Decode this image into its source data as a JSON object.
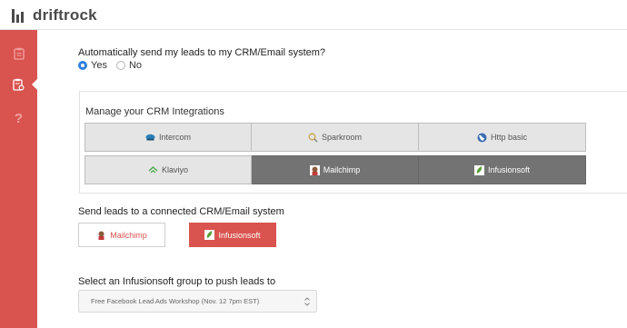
{
  "app": {
    "brand": "driftrock"
  },
  "sidebar": {
    "items": [
      {
        "icon": "clipboard-icon",
        "active": false
      },
      {
        "icon": "clipboard-settings-icon",
        "active": true
      },
      {
        "icon": "help-icon",
        "label": "?",
        "active": false
      }
    ]
  },
  "auto_send": {
    "question": "Automatically send my leads to my CRM/Email system?",
    "options": [
      {
        "label": "Yes",
        "checked": true
      },
      {
        "label": "No",
        "checked": false
      }
    ]
  },
  "crm": {
    "title": "Manage your CRM Integrations",
    "integrations": [
      {
        "label": "Intercom",
        "icon": "intercom-icon",
        "connected": false
      },
      {
        "label": "Sparkroom",
        "icon": "sparkroom-icon",
        "connected": false
      },
      {
        "label": "Http basic",
        "icon": "globe-icon",
        "connected": false
      },
      {
        "label": "Klaviyo",
        "icon": "klaviyo-icon",
        "connected": false
      },
      {
        "label": "Mailchimp",
        "icon": "mailchimp-icon",
        "connected": true
      },
      {
        "label": "Infusionsoft",
        "icon": "infusionsoft-icon",
        "connected": true
      }
    ]
  },
  "send_leads": {
    "label": "Send leads to a connected CRM/Email system",
    "options": [
      {
        "label": "Mailchimp",
        "selected": false
      },
      {
        "label": "Infusionsoft",
        "selected": true
      }
    ]
  },
  "group": {
    "label": "Select an Infusionsoft group to push leads to",
    "selected": "Free Facebook Lead Ads Workshop (Nov. 12 7pm EST)"
  },
  "colors": {
    "accent": "#d9534f",
    "connected_bg": "#737373",
    "radio_checked": "#2f7fe0"
  }
}
